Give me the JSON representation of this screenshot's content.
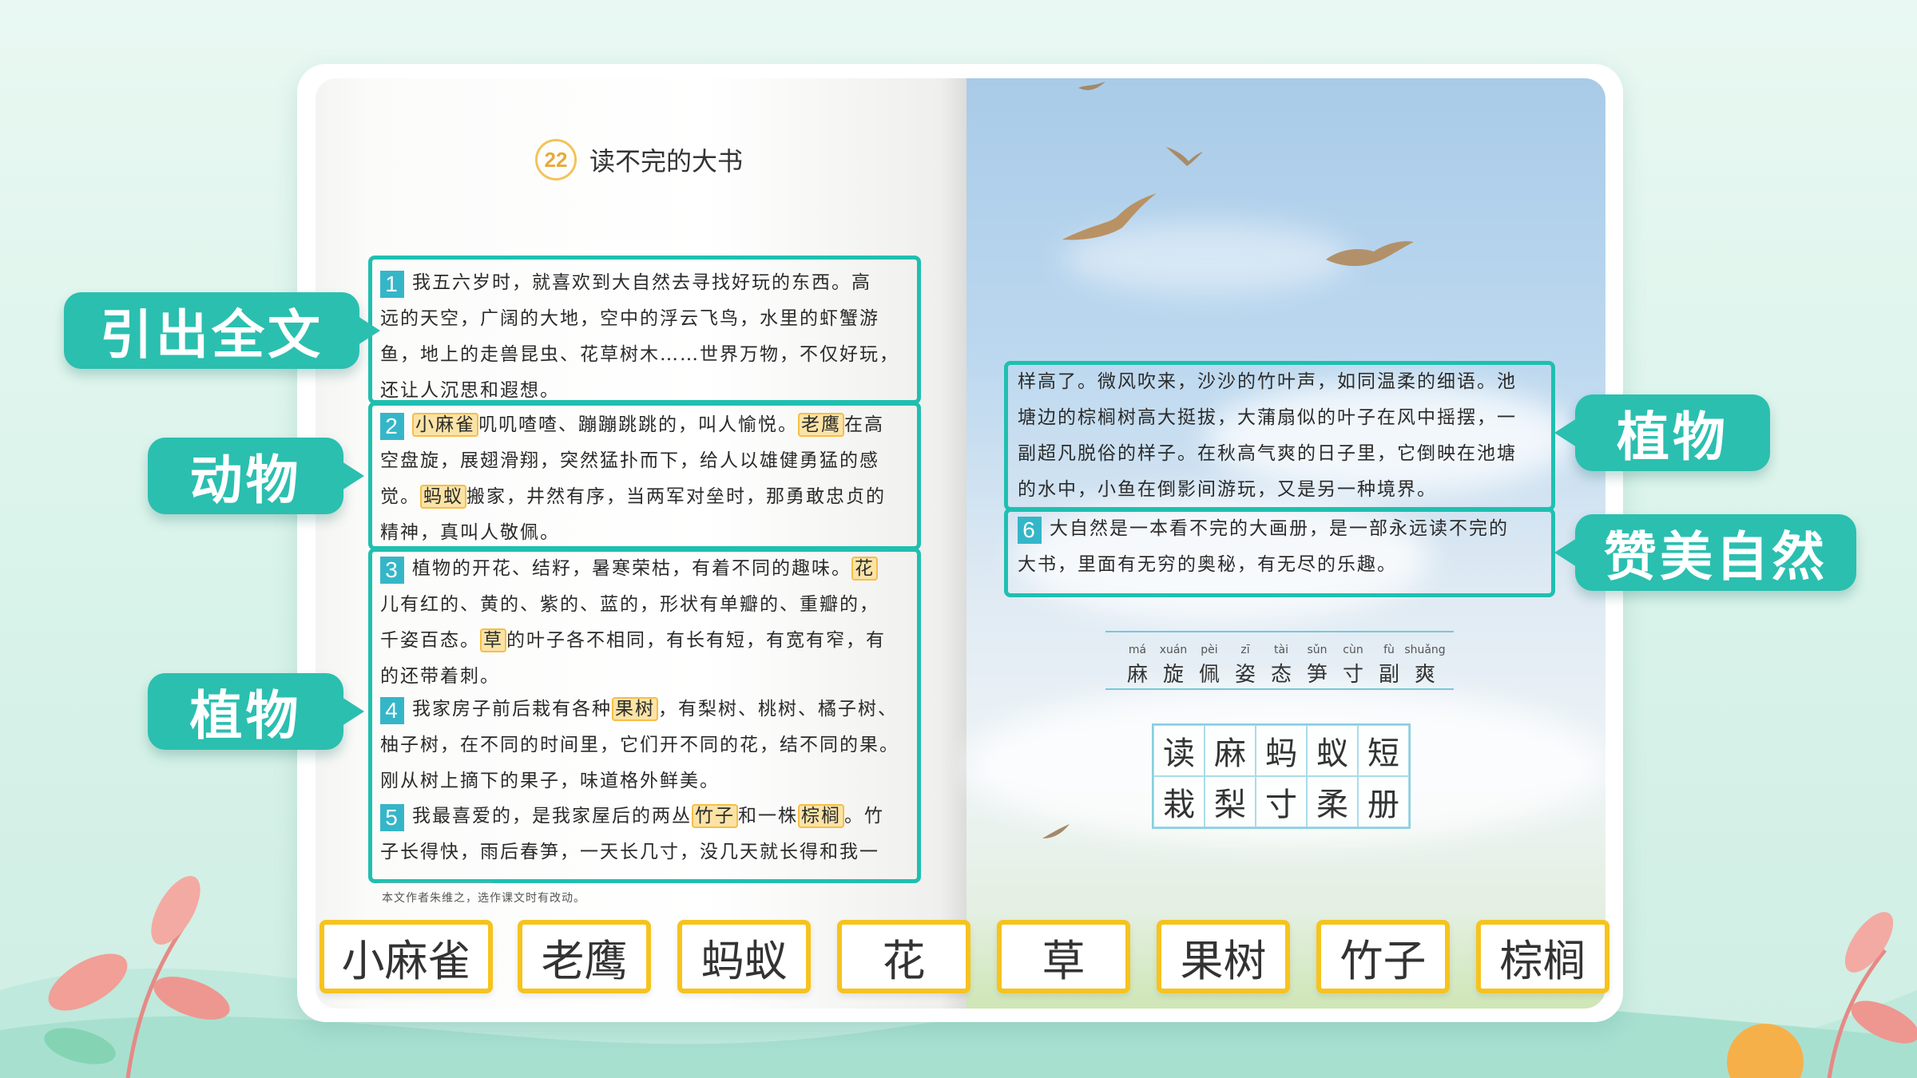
{
  "lesson": {
    "number": "22",
    "title": "读不完的大书",
    "note": "本文作者朱维之，选作课文时有改动。"
  },
  "paragraphs": [
    {
      "num": "1",
      "lines": [
        [
          {
            "t": "我五六岁时，就喜欢到大自然去寻找好玩的东西。高"
          }
        ],
        [
          {
            "t": "远的天空，广阔的大地，空中的浮云飞鸟，水里的虾蟹游"
          }
        ],
        [
          {
            "t": "鱼，地上的走兽昆虫、花草树木……世界万物，不仅好玩，"
          }
        ],
        [
          {
            "t": "还让人沉思和遐想。"
          }
        ]
      ]
    },
    {
      "num": "2",
      "lines": [
        [
          {
            "t": "小麻雀",
            "hl": true
          },
          {
            "t": "叽叽喳喳、蹦蹦跳跳的，叫人愉悦。"
          },
          {
            "t": "老鹰",
            "hl": true
          },
          {
            "t": "在高"
          }
        ],
        [
          {
            "t": "空盘旋，展翅滑翔，突然猛扑而下，给人以雄健勇猛的感"
          }
        ],
        [
          {
            "t": "觉。"
          },
          {
            "t": "蚂蚁",
            "hl": true
          },
          {
            "t": "搬家，井然有序，当两军对垒时，那勇敢忠贞的"
          }
        ],
        [
          {
            "t": "精神，真叫人敬佩。"
          }
        ]
      ]
    },
    {
      "num": "3",
      "lines": [
        [
          {
            "t": "植物的开花、结籽，暑寒荣枯，有着不同的趣味。"
          },
          {
            "t": "花",
            "hl": true
          }
        ],
        [
          {
            "t": "儿有红的、黄的、紫的、蓝的，形状有单瓣的、重瓣的，"
          }
        ],
        [
          {
            "t": "千姿百态。"
          },
          {
            "t": "草",
            "hl": true
          },
          {
            "t": "的叶子各不相同，有长有短，有宽有窄，有"
          }
        ],
        [
          {
            "t": "的还带着刺。"
          }
        ]
      ]
    },
    {
      "num": "4",
      "lines": [
        [
          {
            "t": "我家房子前后栽有各种"
          },
          {
            "t": "果树",
            "hl": true
          },
          {
            "t": "，有梨树、桃树、橘子树、"
          }
        ],
        [
          {
            "t": "柚子树，在不同的时间里，它们开不同的花，结不同的果。"
          }
        ],
        [
          {
            "t": "刚从树上摘下的果子，味道格外鲜美。"
          }
        ]
      ]
    },
    {
      "num": "5",
      "lines": [
        [
          {
            "t": "我最喜爱的，是我家屋后的两丛"
          },
          {
            "t": "竹子",
            "hl": true
          },
          {
            "t": "和一株"
          },
          {
            "t": "棕榈",
            "hl": true
          },
          {
            "t": "。竹"
          }
        ],
        [
          {
            "t": "子长得快，雨后春笋，一天长几寸，没几天就长得和我一"
          }
        ]
      ]
    }
  ],
  "right_paragraphs": [
    {
      "num": "",
      "lines": [
        [
          {
            "t": "样高了。微风吹来，沙沙的竹叶声，如同温柔的细语。池"
          }
        ],
        [
          {
            "t": "塘边的棕榈树高大挺拔，大蒲扇似的叶子在风中摇摆，一"
          }
        ],
        [
          {
            "t": "副超凡脱俗的样子。在秋高气爽的日子里，它倒映在池塘"
          }
        ],
        [
          {
            "t": "的水中，小鱼在倒影间游玩，又是另一种境界。"
          }
        ]
      ]
    },
    {
      "num": "6",
      "lines": [
        [
          {
            "t": "大自然是一本看不完的大画册，是一部永远读不完的"
          }
        ],
        [
          {
            "t": "大书，里面有无穷的奥秘，有无尽的乐趣。"
          }
        ]
      ]
    }
  ],
  "vocab": [
    {
      "py": "má",
      "hz": "麻"
    },
    {
      "py": "xuán",
      "hz": "旋"
    },
    {
      "py": "pèi",
      "hz": "佩"
    },
    {
      "py": "zī",
      "hz": "姿"
    },
    {
      "py": "tài",
      "hz": "态"
    },
    {
      "py": "sǔn",
      "hz": "笋"
    },
    {
      "py": "cùn",
      "hz": "寸"
    },
    {
      "py": "fù",
      "hz": "副"
    },
    {
      "py": "shuǎng",
      "hz": "爽"
    }
  ],
  "write_grid": [
    "读",
    "麻",
    "蚂",
    "蚁",
    "短",
    "栽",
    "梨",
    "寸",
    "柔",
    "册"
  ],
  "tags": {
    "intro": "引出全文",
    "animals": "动物",
    "plants_left": "植物",
    "plants_right": "植物",
    "praise": "赞美自然"
  },
  "word_cards": [
    "小麻雀",
    "老鹰",
    "蚂蚁",
    "花",
    "草",
    "果树",
    "竹子",
    "棕榈"
  ],
  "colors": {
    "teal": "#2bbfb0",
    "box_border": "#1fbfb0",
    "highlight": "#fbe3a6",
    "card_border": "#f6c31e"
  }
}
